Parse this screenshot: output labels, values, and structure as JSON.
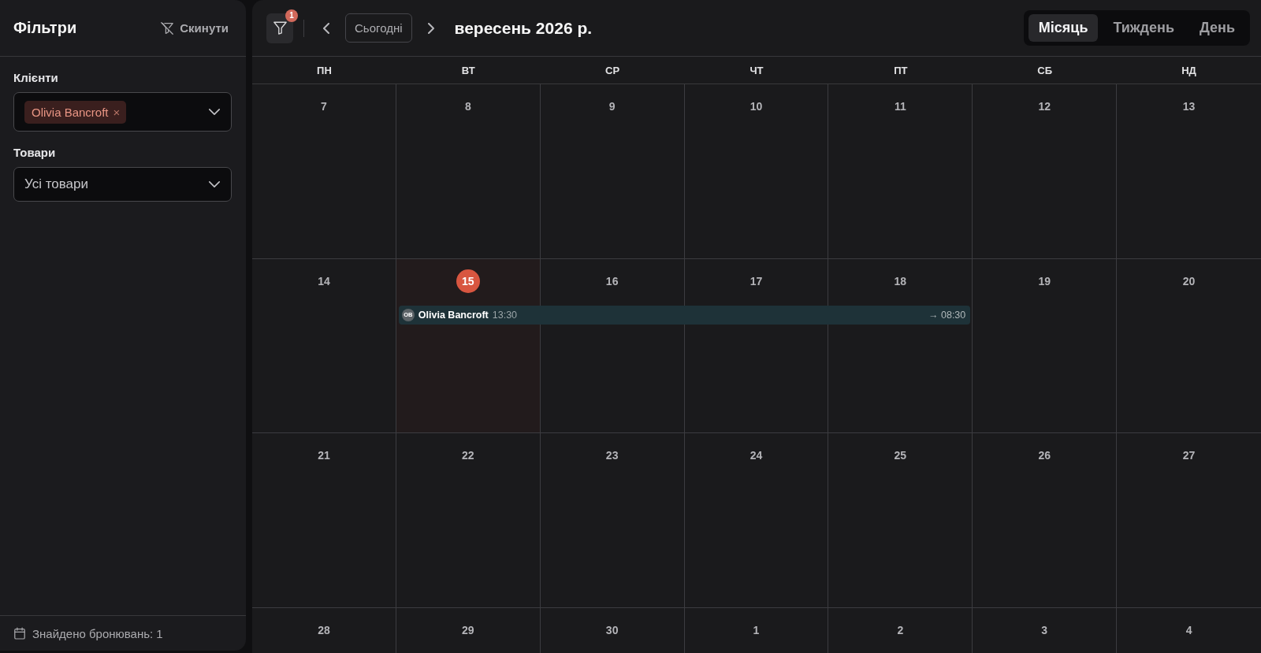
{
  "sidebar": {
    "title": "Фільтри",
    "reset_button": "Скинути",
    "filters": [
      {
        "kind": "tags",
        "label": "Клієнти",
        "tags": [
          {
            "label": "Olivia Bancroft",
            "remove": "×"
          }
        ]
      },
      {
        "kind": "select",
        "label": "Товари",
        "value": "Усі товари"
      }
    ],
    "footer": "Знайдено бронювань: 1"
  },
  "toolbar": {
    "filter_badge": "1",
    "today_button": "Сьогодні",
    "title": "вересень 2026 р.",
    "views": [
      {
        "label": "Місяць",
        "selected": true
      },
      {
        "label": "Тиждень",
        "selected": false
      },
      {
        "label": "День",
        "selected": false
      }
    ]
  },
  "calendar": {
    "weekdays": [
      "ПН",
      "ВТ",
      "СР",
      "ЧТ",
      "ПТ",
      "СБ",
      "НД"
    ],
    "weeks": [
      {
        "days": [
          {
            "day": "7",
            "today": false,
            "continued": false
          },
          {
            "day": "8",
            "today": false,
            "continued": false
          },
          {
            "day": "9",
            "today": false,
            "continued": false
          },
          {
            "day": "10",
            "today": false,
            "continued": false
          },
          {
            "day": "11",
            "today": false,
            "continued": false
          },
          {
            "day": "12",
            "today": false,
            "continued": false
          },
          {
            "day": "13",
            "today": false,
            "continued": false
          }
        ]
      },
      {
        "days": [
          {
            "day": "14",
            "today": false,
            "continued": false
          },
          {
            "day": "15",
            "today": true,
            "continued": false,
            "events": [
              {
                "avatar": "OB",
                "name": "Olivia Bancroft",
                "start": "13:30",
                "end": "→ 08:30"
              }
            ]
          },
          {
            "day": "16",
            "today": false,
            "continued": true
          },
          {
            "day": "17",
            "today": false,
            "continued": true
          },
          {
            "day": "18",
            "today": false,
            "continued": true
          },
          {
            "day": "19",
            "today": false,
            "continued": false
          },
          {
            "day": "20",
            "today": false,
            "continued": false
          }
        ]
      },
      {
        "days": [
          {
            "day": "21",
            "today": false,
            "continued": false
          },
          {
            "day": "22",
            "today": false,
            "continued": false
          },
          {
            "day": "23",
            "today": false,
            "continued": false
          },
          {
            "day": "24",
            "today": false,
            "continued": false
          },
          {
            "day": "25",
            "today": false,
            "continued": false
          },
          {
            "day": "26",
            "today": false,
            "continued": false
          },
          {
            "day": "27",
            "today": false,
            "continued": false
          }
        ]
      },
      {
        "days": [
          {
            "day": "28",
            "today": false,
            "continued": false
          },
          {
            "day": "29",
            "today": false,
            "continued": false
          },
          {
            "day": "30",
            "today": false,
            "continued": false
          },
          {
            "day": "1",
            "today": false,
            "continued": false
          },
          {
            "day": "2",
            "today": false,
            "continued": false
          },
          {
            "day": "3",
            "today": false,
            "continued": false
          },
          {
            "day": "4",
            "today": false,
            "continued": false
          }
        ]
      }
    ]
  }
}
